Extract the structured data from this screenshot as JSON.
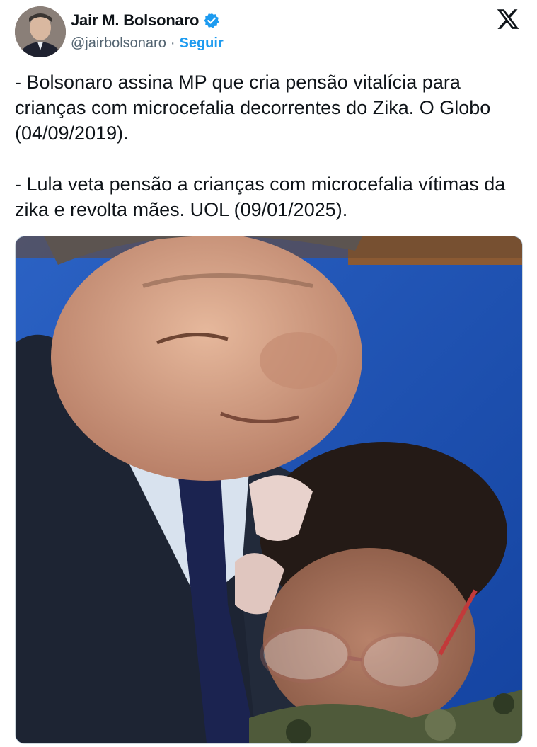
{
  "author": {
    "display_name": "Jair M. Bolsonaro",
    "handle": "@jairbolsonaro",
    "separator": "·",
    "follow_label": "Seguir"
  },
  "platform_logo": "x-logo",
  "tweet": {
    "paragraph_1": "- Bolsonaro assina MP que cria pensão vitalícia para crianças com microcefalia decorrentes do Zika. O Globo (04/09/2019).",
    "paragraph_2": "- Lula veta pensão a crianças com microcefalia vítimas da zika e revolta mães. UOL (09/01/2025)."
  },
  "media": {
    "type": "photo"
  },
  "colors": {
    "link_blue": "#1d9bf0",
    "text_primary": "#0f1419",
    "text_secondary": "#536471"
  }
}
